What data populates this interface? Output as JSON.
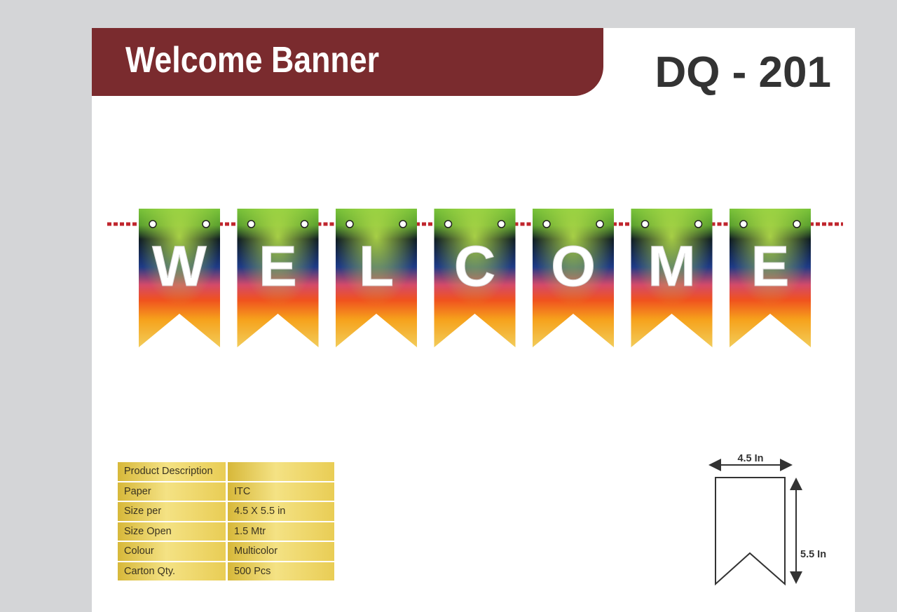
{
  "header": {
    "title": "Welcome Banner",
    "code": "DQ - 201"
  },
  "banner": {
    "letters": [
      "W",
      "E",
      "L",
      "C",
      "O",
      "M",
      "E"
    ]
  },
  "specs": {
    "rows": [
      {
        "key": "Product Description",
        "value": ""
      },
      {
        "key": "Paper",
        "value": "ITC"
      },
      {
        "key": "Size per",
        "value": "4.5 X 5.5 in"
      },
      {
        "key": "Size Open",
        "value": "1.5 Mtr"
      },
      {
        "key": "Colour",
        "value": "Multicolor"
      },
      {
        "key": "Carton Qty.",
        "value": "500 Pcs"
      }
    ]
  },
  "dimensions": {
    "width_label": "4.5 In",
    "height_label": "5.5 In"
  },
  "colors": {
    "title_bar": "#7a2b2e",
    "code_text": "#333333",
    "rope": "#c0262d",
    "table_gold": "#ecd264"
  }
}
